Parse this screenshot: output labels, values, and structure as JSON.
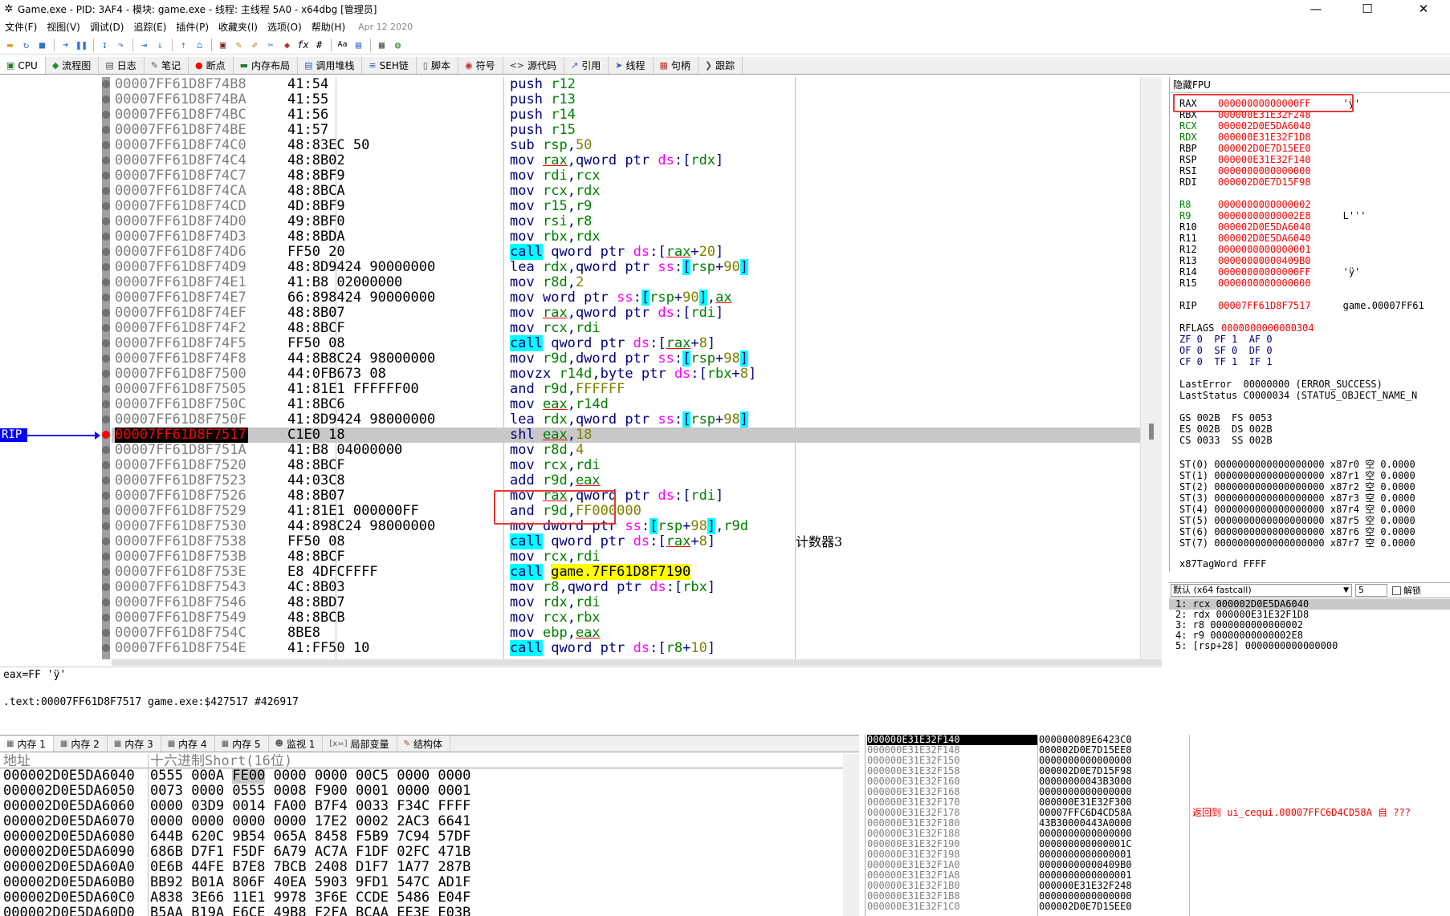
{
  "window": {
    "title": "Game.exe - PID: 3AF4 - 模块: game.exe - 线程: 主线程 5A0 - x64dbg [管理员]"
  },
  "menu": {
    "items": [
      "文件(F)",
      "视图(V)",
      "调试(D)",
      "追踪(E)",
      "插件(P)",
      "收藏夹(I)",
      "选项(O)",
      "帮助(H)"
    ],
    "date": "Apr 12 2020"
  },
  "tabs": [
    {
      "label": "CPU",
      "icon": "cpu-icon",
      "glyph": "▣",
      "color": "#2a7a2a"
    },
    {
      "label": "流程图",
      "icon": "graph-icon",
      "glyph": "◆",
      "color": "#2a8a2a"
    },
    {
      "label": "日志",
      "icon": "log-icon",
      "glyph": "▤",
      "color": "#555555"
    },
    {
      "label": "笔记",
      "icon": "notes-icon",
      "glyph": "✎",
      "color": "#555555"
    },
    {
      "label": "断点",
      "icon": "breakpoint-icon",
      "glyph": "●",
      "color": "#ff0000"
    },
    {
      "label": "内存布局",
      "icon": "memory-map-icon",
      "glyph": "▬",
      "color": "#2a7a2a"
    },
    {
      "label": "调用堆栈",
      "icon": "callstack-icon",
      "glyph": "▤",
      "color": "#3060c0"
    },
    {
      "label": "SEH链",
      "icon": "seh-icon",
      "glyph": "≡",
      "color": "#3060c0"
    },
    {
      "label": "脚本",
      "icon": "script-icon",
      "glyph": "▯",
      "color": "#555555"
    },
    {
      "label": "符号",
      "icon": "symbols-icon",
      "glyph": "◉",
      "color": "#c03030"
    },
    {
      "label": "源代码",
      "icon": "source-icon",
      "glyph": "<>",
      "color": "#333333"
    },
    {
      "label": "引用",
      "icon": "references-icon",
      "glyph": "↗",
      "color": "#3060c0"
    },
    {
      "label": "线程",
      "icon": "threads-icon",
      "glyph": "➤",
      "color": "#3060c0"
    },
    {
      "label": "句柄",
      "icon": "handles-icon",
      "glyph": "▦",
      "color": "#c03030"
    },
    {
      "label": "跟踪",
      "icon": "trace-icon",
      "glyph": "❯",
      "color": "#555555"
    }
  ],
  "disasm": {
    "rows": [
      {
        "addr": "00007FF61D8F74B8",
        "bytes": "41:54",
        "asm": "push r12",
        "dot": true
      },
      {
        "addr": "00007FF61D8F74BA",
        "bytes": "41:55",
        "asm": "push r13",
        "dot": true
      },
      {
        "addr": "00007FF61D8F74BC",
        "bytes": "41:56",
        "asm": "push r14",
        "dot": true
      },
      {
        "addr": "00007FF61D8F74BE",
        "bytes": "41:57",
        "asm": "push r15",
        "dot": true
      },
      {
        "addr": "00007FF61D8F74C0",
        "bytes": "48:83EC 50",
        "asm": "sub rsp,50",
        "dot": true
      },
      {
        "addr": "00007FF61D8F74C4",
        "bytes": "48:8B02",
        "asm": "mov rax,qword ptr ds:[rdx]",
        "dot": true
      },
      {
        "addr": "00007FF61D8F74C7",
        "bytes": "48:8BF9",
        "asm": "mov rdi,rcx",
        "dot": true
      },
      {
        "addr": "00007FF61D8F74CA",
        "bytes": "48:8BCA",
        "asm": "mov rcx,rdx",
        "dot": true
      },
      {
        "addr": "00007FF61D8F74CD",
        "bytes": "4D:8BF9",
        "asm": "mov r15,r9",
        "dot": true
      },
      {
        "addr": "00007FF61D8F74D0",
        "bytes": "49:8BF0",
        "asm": "mov rsi,r8",
        "dot": true
      },
      {
        "addr": "00007FF61D8F74D3",
        "bytes": "48:8BDA",
        "asm": "mov rbx,rdx",
        "dot": true
      },
      {
        "addr": "00007FF61D8F74D6",
        "bytes": "FF50 20",
        "asm": "call qword ptr ds:[rax+20]",
        "dot": true
      },
      {
        "addr": "00007FF61D8F74D9",
        "bytes": "48:8D9424 90000000",
        "asm": "lea rdx,qword ptr ss:[rsp+90]",
        "dot": true
      },
      {
        "addr": "00007FF61D8F74E1",
        "bytes": "41:B8 02000000",
        "asm": "mov r8d,2",
        "dot": true
      },
      {
        "addr": "00007FF61D8F74E7",
        "bytes": "66:898424 90000000",
        "asm": "mov word ptr ss:[rsp+90],ax",
        "dot": true
      },
      {
        "addr": "00007FF61D8F74EF",
        "bytes": "48:8B07",
        "asm": "mov rax,qword ptr ds:[rdi]",
        "dot": true
      },
      {
        "addr": "00007FF61D8F74F2",
        "bytes": "48:8BCF",
        "asm": "mov rcx,rdi",
        "dot": true
      },
      {
        "addr": "00007FF61D8F74F5",
        "bytes": "FF50 08",
        "asm": "call qword ptr ds:[rax+8]",
        "dot": true
      },
      {
        "addr": "00007FF61D8F74F8",
        "bytes": "44:8B8C24 98000000",
        "asm": "mov r9d,dword ptr ss:[rsp+98]",
        "dot": true
      },
      {
        "addr": "00007FF61D8F7500",
        "bytes": "44:0FB673 08",
        "asm": "movzx r14d,byte ptr ds:[rbx+8]",
        "dot": true
      },
      {
        "addr": "00007FF61D8F7505",
        "bytes": "41:81E1 FFFFFF00",
        "asm": "and r9d,FFFFFF",
        "dot": true
      },
      {
        "addr": "00007FF61D8F750C",
        "bytes": "41:8BC6",
        "asm": "mov eax,r14d",
        "dot": true
      },
      {
        "addr": "00007FF61D8F750F",
        "bytes": "41:8D9424 98000000",
        "asm": "lea rdx,qword ptr ss:[rsp+98]",
        "dot": true
      },
      {
        "addr": "00007FF61D8F7517",
        "bytes": "C1E0 18",
        "asm": "shl eax,18",
        "dot": true,
        "rip": true
      },
      {
        "addr": "00007FF61D8F751A",
        "bytes": "41:B8 04000000",
        "asm": "mov r8d,4",
        "dot": true
      },
      {
        "addr": "00007FF61D8F7520",
        "bytes": "48:8BCF",
        "asm": "mov rcx,rdi",
        "dot": true
      },
      {
        "addr": "00007FF61D8F7523",
        "bytes": "44:03C8",
        "asm": "add r9d,eax",
        "dot": true
      },
      {
        "addr": "00007FF61D8F7526",
        "bytes": "48:8B07",
        "asm": "mov rax,qword ptr ds:[rdi]",
        "dot": true
      },
      {
        "addr": "00007FF61D8F7529",
        "bytes": "41:81E1 000000FF",
        "asm": "and r9d,FF000000",
        "dot": true
      },
      {
        "addr": "00007FF61D8F7530",
        "bytes": "44:898C24 98000000",
        "asm": "mov dword ptr ss:[rsp+98],r9d",
        "dot": true
      },
      {
        "addr": "00007FF61D8F7538",
        "bytes": "FF50 08",
        "asm": "call qword ptr ds:[rax+8]",
        "dot": true,
        "comment": "计数器3"
      },
      {
        "addr": "00007FF61D8F753B",
        "bytes": "48:8BCF",
        "asm": "mov rcx,rdi",
        "dot": true
      },
      {
        "addr": "00007FF61D8F753E",
        "bytes": "E8 4DFCFFFF",
        "asm": "call game.7FF61D8F7190",
        "dot": true
      },
      {
        "addr": "00007FF61D8F7543",
        "bytes": "4C:8B03",
        "asm": "mov r8,qword ptr ds:[rbx]",
        "dot": true
      },
      {
        "addr": "00007FF61D8F7546",
        "bytes": "48:8BD7",
        "asm": "mov rdx,rdi",
        "dot": true
      },
      {
        "addr": "00007FF61D8F7549",
        "bytes": "48:8BCB",
        "asm": "mov rcx,rbx",
        "dot": true
      },
      {
        "addr": "00007FF61D8F754C",
        "bytes": "8BE8",
        "asm": "mov ebp,eax",
        "dot": true
      },
      {
        "addr": "00007FF61D8F754E",
        "bytes": "41:FF50 10",
        "asm": "call qword ptr ds:[r8+10]",
        "dot": true
      }
    ],
    "rip_label": "RIP"
  },
  "info": {
    "line1": "eax=FF 'ÿ'",
    "line2": ".text:00007FF61D8F7517 game.exe:$427517 #426917"
  },
  "registers": {
    "header": "隐藏FPU",
    "gp": [
      {
        "name": "RAX",
        "value": "00000000000000FF",
        "comment": "'ÿ'",
        "changed": false
      },
      {
        "name": "RBX",
        "value": "000000E31E32F248",
        "comment": "",
        "changed": false
      },
      {
        "name": "RCX",
        "value": "000002D0E5DA6040",
        "comment": "",
        "changed": true
      },
      {
        "name": "RDX",
        "value": "000000E31E32F1D8",
        "comment": "",
        "changed": true
      },
      {
        "name": "RBP",
        "value": "000002D0E7D15EE0",
        "comment": "",
        "changed": false
      },
      {
        "name": "RSP",
        "value": "000000E31E32F140",
        "comment": "",
        "changed": false
      },
      {
        "name": "RSI",
        "value": "0000000000000000",
        "comment": "",
        "changed": false
      },
      {
        "name": "RDI",
        "value": "000002D0E7D15F98",
        "comment": "",
        "changed": false
      }
    ],
    "ext": [
      {
        "name": "R8",
        "value": "0000000000000002",
        "comment": "",
        "changed": true
      },
      {
        "name": "R9",
        "value": "00000000000002E8",
        "comment": "L'ˈ'",
        "changed": true
      },
      {
        "name": "R10",
        "value": "000002D0E5DA6040",
        "comment": "",
        "changed": false
      },
      {
        "name": "R11",
        "value": "000002D0E5DA6040",
        "comment": "",
        "changed": false
      },
      {
        "name": "R12",
        "value": "0000000000000001",
        "comment": "",
        "changed": false
      },
      {
        "name": "R13",
        "value": "00000000000409B0",
        "comment": "",
        "changed": false
      },
      {
        "name": "R14",
        "value": "00000000000000FF",
        "comment": "'ÿ'",
        "changed": false
      },
      {
        "name": "R15",
        "value": "0000000000000000",
        "comment": "",
        "changed": false
      }
    ],
    "rip": {
      "name": "RIP",
      "value": "00007FF61D8F7517",
      "comment": "game.00007FF61"
    },
    "rflags": {
      "name": "RFLAGS",
      "value": "0000000000000304"
    },
    "flags": [
      "ZF 0  PF 1  AF 0",
      "OF 0  SF 0  DF 0",
      "CF 0  TF 1  IF 1"
    ],
    "last": [
      "LastError  00000000 (ERROR_SUCCESS)",
      "LastStatus C0000034 (STATUS_OBJECT_NAME_N"
    ],
    "segs": [
      "GS 002B  FS 0053",
      "ES 002B  DS 002B",
      "CS 0033  SS 002B"
    ],
    "st": [
      "ST(0) 0000000000000000000 x87r0 空 0.0000",
      "ST(1) 0000000000000000000 x87r1 空 0.0000",
      "ST(2) 0000000000000000000 x87r2 空 0.0000",
      "ST(3) 0000000000000000000 x87r3 空 0.0000",
      "ST(4) 0000000000000000000 x87r4 空 0.0000",
      "ST(5) 0000000000000000000 x87r5 空 0.0000",
      "ST(6) 0000000000000000000 x87r6 空 0.0000",
      "ST(7) 0000000000000000000 x87r7 空 0.0000"
    ],
    "tagword": "x87TagWord FFFF"
  },
  "callconv": {
    "selected": "默认 (x64 fastcall)",
    "count": "5",
    "unlock": "解锁",
    "args": [
      "1: rcx 000002D0E5DA6040",
      "2: rdx 000000E31E32F1D8",
      "3: r8 0000000000000002",
      "4: r9 00000000000002E8",
      "5: [rsp+28] 0000000000000000"
    ]
  },
  "bottom_tabs": [
    "内存 1",
    "内存 2",
    "内存 3",
    "内存 4",
    "内存 5",
    "监视 1",
    "局部变量",
    "结构体"
  ],
  "dump": {
    "headers": {
      "addr": "地址",
      "hex": "十六进制Short(16位)"
    },
    "rows": [
      {
        "addr": "000002D0E5DA6040",
        "hex": [
          "0555",
          "000A",
          "FE00",
          "0000",
          "0000",
          "00C5",
          "0000",
          "0000"
        ]
      },
      {
        "addr": "000002D0E5DA6050",
        "hex": [
          "0073",
          "0000",
          "0555",
          "0008",
          "F900",
          "0001",
          "0000",
          "0001"
        ]
      },
      {
        "addr": "000002D0E5DA6060",
        "hex": [
          "0000",
          "03D9",
          "0014",
          "FA00",
          "B7F4",
          "0033",
          "F34C",
          "FFFF"
        ]
      },
      {
        "addr": "000002D0E5DA6070",
        "hex": [
          "0000",
          "0000",
          "0000",
          "0000",
          "17E2",
          "0002",
          "2AC3",
          "6641"
        ]
      },
      {
        "addr": "000002D0E5DA6080",
        "hex": [
          "644B",
          "620C",
          "9B54",
          "065A",
          "8458",
          "F5B9",
          "7C94",
          "57DF"
        ]
      },
      {
        "addr": "000002D0E5DA6090",
        "hex": [
          "686B",
          "D7F1",
          "F5DF",
          "6A79",
          "AC7A",
          "F1DF",
          "02FC",
          "471B"
        ]
      },
      {
        "addr": "000002D0E5DA60A0",
        "hex": [
          "0E6B",
          "44FE",
          "B7E8",
          "7BCB",
          "2408",
          "D1F7",
          "1A77",
          "287B"
        ]
      },
      {
        "addr": "000002D0E5DA60B0",
        "hex": [
          "BB92",
          "B01A",
          "806F",
          "40EA",
          "5903",
          "9FD1",
          "547C",
          "AD1F"
        ]
      },
      {
        "addr": "000002D0E5DA60C0",
        "hex": [
          "A838",
          "3E66",
          "11E1",
          "9978",
          "3F6E",
          "CCDE",
          "5486",
          "E04F"
        ]
      },
      {
        "addr": "000002D0E5DA60D0",
        "hex": [
          "B5AA",
          "B19A",
          "E6CE",
          "49B8",
          "F2FA",
          "BCAA",
          "EE3E",
          "E03B"
        ]
      }
    ]
  },
  "stack": {
    "rows": [
      {
        "addr": "000000E31E32F140",
        "val": "000000089E6423C0",
        "cmt": ""
      },
      {
        "addr": "000000E31E32F148",
        "val": "000002D0E7D15EE0",
        "cmt": ""
      },
      {
        "addr": "000000E31E32F150",
        "val": "0000000000000000",
        "cmt": ""
      },
      {
        "addr": "000000E31E32F158",
        "val": "000002D0E7D15F98",
        "cmt": ""
      },
      {
        "addr": "000000E31E32F160",
        "val": "00000000043B3000",
        "cmt": ""
      },
      {
        "addr": "000000E31E32F168",
        "val": "0000000000000000",
        "cmt": ""
      },
      {
        "addr": "000000E31E32F170",
        "val": "000000E31E32F300",
        "cmt": ""
      },
      {
        "addr": "000000E31E32F178",
        "val": "00007FFC6D4CD58A",
        "cmt": "返回到 ui_cequi.00007FFC6D4CD58A 自 ???"
      },
      {
        "addr": "000000E31E32F180",
        "val": "43B30000443A0000",
        "cmt": ""
      },
      {
        "addr": "000000E31E32F188",
        "val": "0000000000000000",
        "cmt": ""
      },
      {
        "addr": "000000E31E32F190",
        "val": "000000000000001C",
        "cmt": ""
      },
      {
        "addr": "000000E31E32F198",
        "val": "0000000000000001",
        "cmt": ""
      },
      {
        "addr": "000000E31E32F1A0",
        "val": "00000000000409B0",
        "cmt": ""
      },
      {
        "addr": "000000E31E32F1A8",
        "val": "0000000000000001",
        "cmt": ""
      },
      {
        "addr": "000000E31E32F1B0",
        "val": "000000E31E32F248",
        "cmt": ""
      },
      {
        "addr": "000000E31E32F1B8",
        "val": "0000000000000000",
        "cmt": ""
      },
      {
        "addr": "000000E31E32F1C0",
        "val": "000002D0E7D15EE0",
        "cmt": ""
      }
    ]
  }
}
